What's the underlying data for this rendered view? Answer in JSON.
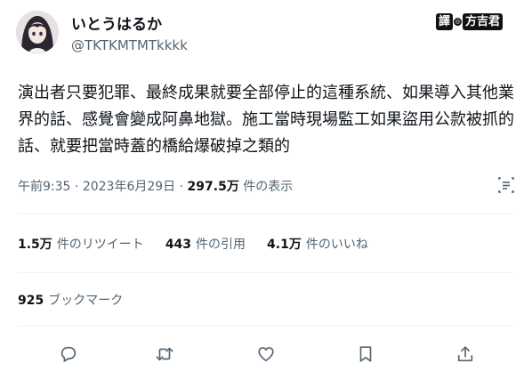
{
  "user": {
    "display_name": "いとうはるか",
    "handle": "@TKTKMTMTkkkk"
  },
  "watermark": {
    "left": "譯",
    "dot": "◎",
    "right": "方吉君"
  },
  "tweet": {
    "text": "演出者只要犯罪、最終成果就要全部停止的這種系統、如果導入其他業界的話、感覺會變成阿鼻地獄。施工當時現場監工如果盜用公款被抓的話、就要把當時蓋的橋給爆破掉之類的"
  },
  "meta": {
    "time": "午前9:35",
    "separator": "·",
    "date": "2023年6月29日",
    "views": "297.5万",
    "views_label": "件の表示"
  },
  "stats": {
    "retweets": "1.5万",
    "retweets_label": "件のリツイート",
    "quotes": "443",
    "quotes_label": "件の引用",
    "likes": "4.1万",
    "likes_label": "件のいいね"
  },
  "bookmarks": {
    "count": "925",
    "label": "ブックマーク"
  },
  "actions": {
    "reply_icon": "reply-icon",
    "retweet_icon": "retweet-icon",
    "like_icon": "heart-icon",
    "bookmark_icon": "bookmark-icon",
    "share_icon": "share-icon"
  },
  "colors": {
    "text": "#0f1419",
    "secondary": "#536471",
    "divider": "#eff3f4"
  }
}
